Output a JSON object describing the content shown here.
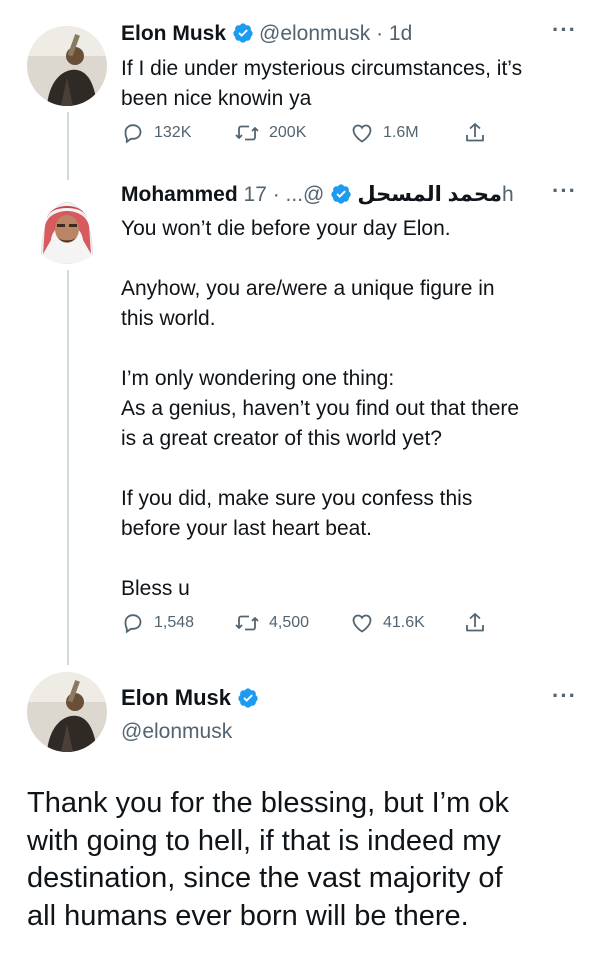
{
  "tweet1": {
    "name": "Elon Musk",
    "handle": "@elonmusk",
    "time": "· 1d",
    "lines": [
      "If I die under mysterious circumstances, it’s",
      "been nice knowin ya"
    ],
    "replies": "132K",
    "retweets": "200K",
    "likes": "1.6M"
  },
  "tweet2": {
    "name": "Mohammed محمد المسحل",
    "handle": "@...",
    "time": "· 17h",
    "lines": [
      "You won’t die before your day Elon.",
      "",
      "Anyhow, you are/were a unique figure in",
      "this world.",
      "",
      "I’m only wondering one thing:",
      "As a genius, haven’t you find out that there",
      "is a great creator of this world yet?",
      "",
      "If you did, make sure you confess this",
      "before your last heart beat.",
      "",
      "Bless u"
    ],
    "replies": "1,548",
    "retweets": "4,500",
    "likes": "41.6K"
  },
  "tweet3": {
    "name": "Elon Musk",
    "handle": "@elonmusk",
    "lines": [
      "Thank you for the blessing, but I’m ok",
      "with going to hell, if that is indeed my",
      "destination, since the vast majority of",
      "all humans ever born will be there."
    ]
  },
  "icons": {
    "verified": "verified-badge-icon",
    "reply": "reply-icon",
    "retweet": "retweet-icon",
    "like": "heart-icon",
    "share": "share-icon",
    "more": "more-options-icon"
  },
  "colors": {
    "verified": "#1d9bf0",
    "text": "#0f1419",
    "muted": "#536471",
    "thread_line": "#cfd9de"
  }
}
